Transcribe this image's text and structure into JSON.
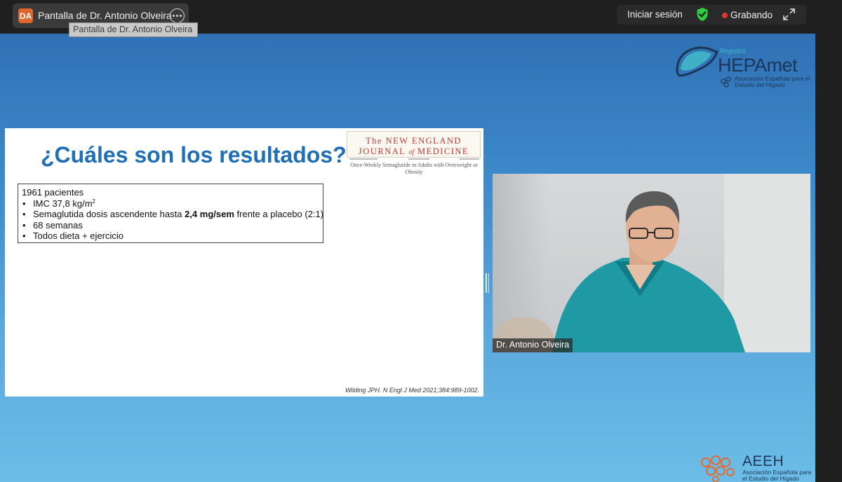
{
  "topbar": {
    "avatar_initials": "DA",
    "share_title": "Pantalla de Dr. Antonio Olveira",
    "tooltip": "Pantalla de Dr. Antonio Olveira",
    "signin_label": "Iniciar sesión",
    "recording_label": "Grabando",
    "icons": [
      "more-options-icon",
      "shield-check-icon",
      "recording-dot-icon",
      "expand-icon"
    ],
    "colors": {
      "avatar": "#e0652a",
      "shield": "#2ecc40",
      "recording": "#e5352c"
    }
  },
  "logos": {
    "hepamet": {
      "registro": "Registro",
      "name": "HEPAmet",
      "subtitle": "Asociación Española para el Estudio del Hígado"
    },
    "aeeh": {
      "name": "AEEH",
      "subtitle": "Asociación Española para el Estudio del Hígado"
    }
  },
  "slide": {
    "title": "¿Cuáles son los resultados?",
    "journal": {
      "line1": "The NEW ENGLAND",
      "line2_a": "JOURNAL",
      "line2_of": "of",
      "line2_b": "MEDICINE"
    },
    "article_title": "Once-Weekly Semaglutide in Adults with Overweight or Obesity",
    "info": {
      "header": "1961 pacientes",
      "bullet1_text": "IMC 37,8 kg/m",
      "bullet1_sup": "2",
      "bullet2_pre": "Semaglutida dosis ascendente hasta ",
      "bullet2_bold": "2,4 mg/sem",
      "bullet2_post": " frente a placebo (2:1)",
      "bullet3": "68 semanas",
      "bullet4": "Todos dieta + ejercicio"
    },
    "citation": "Wilding JPH. N Engl J Med 2021;384:989-1002."
  },
  "video": {
    "participant_name": "Dr. Antonio Olveira"
  }
}
